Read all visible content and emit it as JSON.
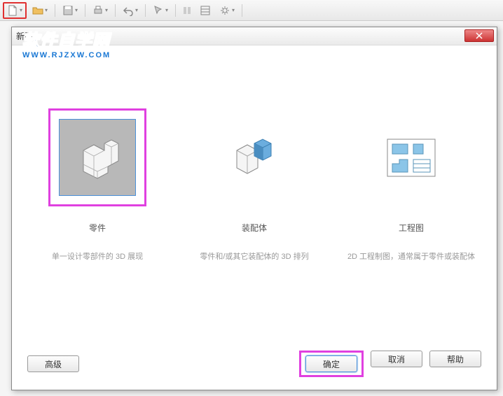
{
  "watermark": {
    "title": "软件自学网",
    "url": "WWW.RJZXW.COM"
  },
  "dialog": {
    "title": "新建",
    "options": [
      {
        "title": "零件",
        "desc": "单一设计零部件的 3D 展现"
      },
      {
        "title": "装配体",
        "desc": "零件和/或其它装配体的 3D 排列"
      },
      {
        "title": "工程图",
        "desc": "2D 工程制图，通常属于零件或装配体"
      }
    ],
    "buttons": {
      "advanced": "高级",
      "ok": "确定",
      "cancel": "取消",
      "help": "帮助"
    }
  }
}
